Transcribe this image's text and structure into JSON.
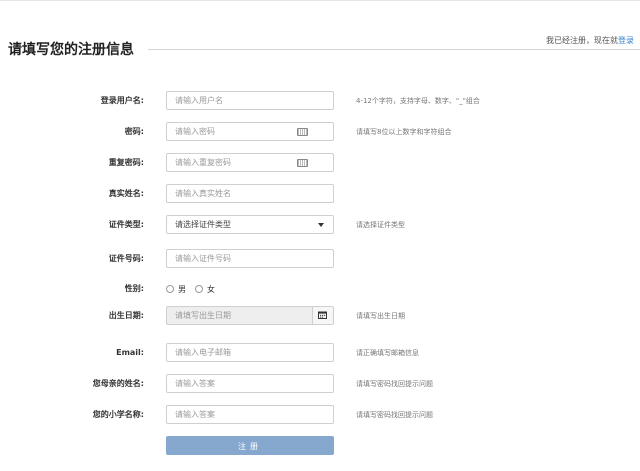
{
  "header": {
    "title": "请填写您的注册信息",
    "login_prompt": "我已经注册，现在就",
    "login_link": "登录"
  },
  "form": {
    "username": {
      "label": "登录用户名:",
      "placeholder": "请输入用户名",
      "hint": "4-12个字符，支持字母、数字、\"_\"组合"
    },
    "password": {
      "label": "密码:",
      "placeholder": "请输入密码",
      "hint": "请填写8位以上数字和字符组合"
    },
    "repeat_password": {
      "label": "重复密码:",
      "placeholder": "请输入重复密码"
    },
    "real_name": {
      "label": "真实姓名:",
      "placeholder": "请输入真实姓名"
    },
    "id_type": {
      "label": "证件类型:",
      "selected": "请选择证件类型",
      "hint": "请选择证件类型"
    },
    "id_number": {
      "label": "证件号码:",
      "placeholder": "请输入证件号码"
    },
    "gender": {
      "label": "性别:",
      "options": [
        "男",
        "女"
      ]
    },
    "birthday": {
      "label": "出生日期:",
      "placeholder": "请填写出生日期",
      "hint": "请填写出生日期"
    },
    "email": {
      "label": "Email:",
      "placeholder": "请输入电子邮箱",
      "hint": "请正确填写邮箱信息"
    },
    "mother_name": {
      "label": "您母亲的姓名:",
      "placeholder": "请输入答案",
      "hint": "请填写密码找回提示问题"
    },
    "school_name": {
      "label": "您的小学名称:",
      "placeholder": "请输入答案",
      "hint": "请填写密码找回提示问题"
    }
  },
  "submit_label": "注册"
}
